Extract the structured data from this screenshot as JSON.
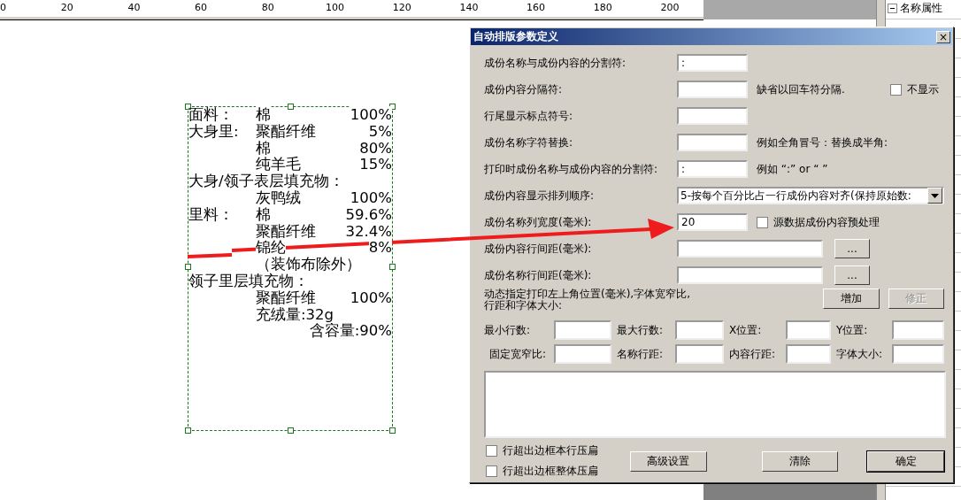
{
  "ruler": {
    "ticks": [
      "0",
      "20",
      "40",
      "60",
      "80",
      "100",
      "120",
      "140",
      "160",
      "180",
      "200"
    ]
  },
  "label_preview": {
    "lines": [
      {
        "kind": "row",
        "name": "面料：",
        "content": "棉",
        "value": "100%"
      },
      {
        "kind": "row",
        "name": "大身里:",
        "content": "聚酯纤维",
        "value": "5%"
      },
      {
        "kind": "row",
        "content": "棉",
        "value": "80%"
      },
      {
        "kind": "row",
        "content": "纯羊毛",
        "value": "15%"
      },
      {
        "kind": "heading",
        "text": "大身/领子表层填充物："
      },
      {
        "kind": "row",
        "content": "灰鸭绒",
        "value": "100%"
      },
      {
        "kind": "row",
        "name": "里料：",
        "content": "棉",
        "value": "59.6%"
      },
      {
        "kind": "row",
        "content": "聚酯纤维",
        "value": "32.4%"
      },
      {
        "kind": "row",
        "content": "锦纶",
        "value": "8%"
      },
      {
        "kind": "note",
        "text": "（装饰布除外）"
      },
      {
        "kind": "heading",
        "text": "领子里层填充物："
      },
      {
        "kind": "row",
        "content": "聚酯纤维",
        "value": "100%"
      },
      {
        "kind": "row",
        "content": "充绒量:32g"
      },
      {
        "kind": "right",
        "text": "含容量:90%"
      }
    ]
  },
  "dialog": {
    "title": "自动排版参数定义",
    "close": "×",
    "rows": [
      {
        "kind": "short",
        "label": "成份名称与成份内容的分割符:",
        "value": ":"
      },
      {
        "kind": "short",
        "label": "成份内容分隔符:",
        "note": "缺省以回车符分隔.",
        "checkbox": {
          "label": "不显示",
          "checked": false
        }
      },
      {
        "kind": "short",
        "label": "行尾显示标点符号:"
      },
      {
        "kind": "short",
        "label": "成份名称字符替换:",
        "note": "例如全角冒号：替换成半角:"
      },
      {
        "kind": "short",
        "label": "打印时成份名称与成份内容的分割符:",
        "value": ":",
        "note": "例如 “:” or “ ”"
      },
      {
        "kind": "select",
        "label": "成份内容显示排列顺序:",
        "value": "5-按每个百分比占一行成份内容对齐(保持原始数:"
      },
      {
        "kind": "short",
        "label": "成份名称列宽度(毫米):",
        "value": "20",
        "checkbox": {
          "label": "源数据成份内容预处理",
          "checked": false
        }
      },
      {
        "kind": "long",
        "label": "成份内容行间距(毫米):",
        "button": "..."
      },
      {
        "kind": "long",
        "label": "成份名称行间距(毫米):",
        "button": "..."
      }
    ],
    "dynamic_text": "动态指定打印左上角位置(毫米),字体宽窄比,\n行距和字体大小:",
    "dynamic_buttons": [
      {
        "label": "增加",
        "disabled": false
      },
      {
        "label": "修正",
        "disabled": true
      }
    ],
    "small_fields": [
      {
        "label": "最小行数:"
      },
      {
        "label": "最大行数:"
      },
      {
        "label": "X位置:"
      },
      {
        "label": "Y位置:"
      },
      {
        "label": "固定宽窄比:"
      },
      {
        "label": "名称行距:"
      },
      {
        "label": "内容行距:"
      },
      {
        "label": "字体大小:"
      }
    ],
    "options": [
      {
        "label": "行超出边框本行压扁",
        "checked": false
      },
      {
        "label": "行超出边框整体压扁",
        "checked": false
      }
    ],
    "buttons": [
      {
        "label": "高级设置",
        "default": false
      },
      {
        "label": "清除",
        "default": false
      },
      {
        "label": "确定",
        "default": true
      }
    ]
  },
  "property_panel": {
    "header": "名称属性"
  }
}
